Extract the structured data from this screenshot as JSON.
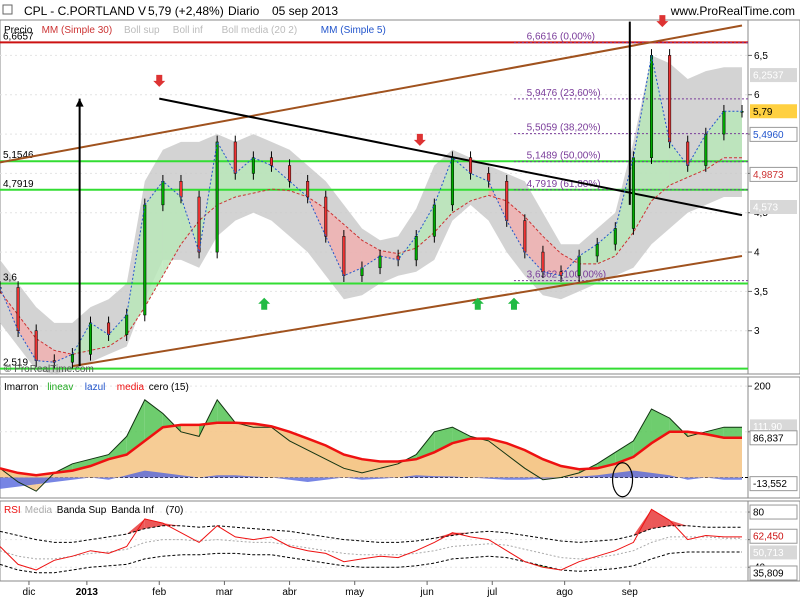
{
  "header": {
    "symbol": "CPL - C.PORTLAND V",
    "price_info": "5,79 (+2,48%)",
    "period": "Diario",
    "date": "05 sep 2013",
    "site": "www.ProRealTime.com"
  },
  "copyright": "© ProRealTime.com",
  "x_axis_labels": [
    "dic",
    "2013",
    "feb",
    "mar",
    "abr",
    "may",
    "jun",
    "jul",
    "ago",
    "sep"
  ],
  "chart_data": [
    {
      "type": "line",
      "panel": "price",
      "legend": [
        "Precio",
        "MM (Simple 30)",
        "Boll sup",
        "Boll inf",
        "Boll media (20 2)",
        "MM (Simple 5)"
      ],
      "colors": {
        "price": "#2255cc",
        "mm30": "#cc3333",
        "boll_band": "#c8c8c8",
        "mm5": "#2255cc",
        "up_fill": "#b8e6b8",
        "down_fill": "#f0b0b0",
        "hline": "#33dd33",
        "resistance": "#cc1111",
        "channel": "#a0521e",
        "trend": "#000000"
      },
      "ylim": [
        2.45,
        6.95
      ],
      "y_ticks": [
        3,
        3.5,
        4,
        4.5,
        5,
        5.5,
        6,
        6.5
      ],
      "y_tick_labels": [
        "3",
        "3,5",
        "4",
        "4,5",
        "5",
        "5,5",
        "6",
        "6,5"
      ],
      "x": [
        0,
        5,
        10,
        15,
        20,
        25,
        30,
        35,
        40,
        45,
        50,
        55,
        60,
        65,
        70,
        75,
        80,
        85,
        90,
        95,
        100,
        105,
        110,
        115,
        120,
        125,
        130,
        135,
        140,
        145,
        150,
        155,
        160,
        165,
        170,
        175,
        180,
        185,
        190,
        195,
        200,
        205
      ],
      "price": [
        3.55,
        3.0,
        2.62,
        2.6,
        2.7,
        3.1,
        2.95,
        3.2,
        4.6,
        4.9,
        4.7,
        4.0,
        5.4,
        5.0,
        5.2,
        5.1,
        4.9,
        4.7,
        4.2,
        3.7,
        3.8,
        3.95,
        3.9,
        4.2,
        4.6,
        5.2,
        5.0,
        4.9,
        4.4,
        4.0,
        3.75,
        3.7,
        3.95,
        4.1,
        4.3,
        5.2,
        6.5,
        5.4,
        5.1,
        5.5,
        5.79,
        5.79
      ],
      "mm30": [
        3.5,
        3.2,
        2.9,
        2.75,
        2.7,
        2.75,
        2.8,
        2.95,
        3.3,
        3.7,
        4.1,
        4.4,
        4.6,
        4.7,
        4.75,
        4.8,
        4.78,
        4.7,
        4.55,
        4.35,
        4.15,
        4.02,
        3.98,
        4.05,
        4.25,
        4.5,
        4.65,
        4.72,
        4.65,
        4.45,
        4.2,
        3.98,
        3.85,
        3.85,
        3.95,
        4.25,
        4.65,
        4.85,
        4.95,
        5.05,
        5.2,
        5.2
      ],
      "boll_upper": [
        3.9,
        3.6,
        3.3,
        3.1,
        3.1,
        3.3,
        3.4,
        3.6,
        4.9,
        5.3,
        5.4,
        5.4,
        5.5,
        5.4,
        5.5,
        5.4,
        5.3,
        5.1,
        4.9,
        4.6,
        4.3,
        4.15,
        4.2,
        4.55,
        5.1,
        5.3,
        5.2,
        5.1,
        5.0,
        4.9,
        4.5,
        4.1,
        4.1,
        4.3,
        4.5,
        5.4,
        6.5,
        6.4,
        6.2,
        6.3,
        6.35,
        6.35
      ],
      "boll_lower": [
        3.1,
        2.8,
        2.5,
        2.45,
        2.5,
        2.6,
        2.7,
        2.8,
        3.4,
        3.9,
        3.9,
        3.8,
        4.2,
        4.4,
        4.5,
        4.4,
        4.2,
        4.0,
        3.7,
        3.4,
        3.45,
        3.6,
        3.7,
        3.75,
        3.9,
        4.4,
        4.6,
        4.4,
        4.0,
        3.7,
        3.45,
        3.4,
        3.5,
        3.6,
        3.7,
        3.8,
        4.1,
        4.3,
        4.5,
        4.6,
        4.7,
        4.7
      ],
      "horizontal_levels": [
        {
          "value": 6.6657,
          "label": "6,6657",
          "color": "#cc1111"
        },
        {
          "value": 5.1546,
          "label": "5,1546",
          "color": "#33dd33"
        },
        {
          "value": 4.7919,
          "label": "4,7919",
          "color": "#33dd33"
        },
        {
          "value": 3.6,
          "label": "3,6",
          "color": "#33dd33"
        },
        {
          "value": 2.519,
          "label": "2,519",
          "color": "#33dd33"
        }
      ],
      "fibonacci": [
        {
          "value": 6.6616,
          "label": "6,6616 (0,00%)"
        },
        {
          "value": 5.9476,
          "label": "5,9476 (23,60%)"
        },
        {
          "value": 5.5059,
          "label": "5,5059 (38,20%)"
        },
        {
          "value": 5.1489,
          "label": "5,1489 (50,00%)"
        },
        {
          "value": 4.7919,
          "label": "4,7919 (61,80%)"
        },
        {
          "value": 3.6362,
          "label": "3,6362 (100,00%)"
        }
      ],
      "channel_upper": {
        "x": [
          0,
          205
        ],
        "y": [
          5.14,
          6.88
        ]
      },
      "channel_lower": {
        "x": [
          20,
          205
        ],
        "y": [
          2.55,
          3.95
        ]
      },
      "downtrend": {
        "x": [
          44,
          205
        ],
        "y": [
          5.95,
          4.47
        ]
      },
      "arrows_down": [
        {
          "x": 44,
          "y": 6.1
        },
        {
          "x": 116,
          "y": 5.35
        },
        {
          "x": 183,
          "y": 6.86
        }
      ],
      "arrows_up": [
        {
          "x": 73,
          "y": 3.42
        },
        {
          "x": 132,
          "y": 3.42
        },
        {
          "x": 142,
          "y": 3.42
        }
      ],
      "verticals": [
        {
          "x": 22,
          "y0": 2.55,
          "y1": 5.95,
          "arrow": true
        },
        {
          "x": 174,
          "y0": 4.6,
          "y1": 6.93,
          "arrow": false
        }
      ],
      "right_labels": [
        {
          "value": 6.25,
          "label": "6,2537",
          "bg": "#d8d8d8",
          "fg": "#ffffff"
        },
        {
          "value": 5.79,
          "label": "5,79",
          "bg": "#ffd040",
          "fg": "#000000"
        },
        {
          "value": 5.496,
          "label": "5,4960",
          "bg": "#ffffff",
          "fg": "#2255cc"
        },
        {
          "value": 4.9873,
          "label": "4,9873",
          "bg": "#ffffff",
          "fg": "#cc3333"
        },
        {
          "value": 4.573,
          "label": "4,573",
          "bg": "#d8d8d8",
          "fg": "#ffffff"
        }
      ]
    },
    {
      "type": "area",
      "panel": "imarron",
      "legend": [
        "Imarron",
        "lineav",
        "lazul",
        "media",
        "cero (15)"
      ],
      "ylim": [
        -45,
        220
      ],
      "y_ticks": [
        100,
        200
      ],
      "y_tick_labels": [
        "100",
        "200"
      ],
      "x": [
        0,
        5,
        10,
        15,
        20,
        25,
        30,
        35,
        40,
        45,
        50,
        55,
        60,
        65,
        70,
        75,
        80,
        85,
        90,
        95,
        100,
        105,
        110,
        115,
        120,
        125,
        130,
        135,
        140,
        145,
        150,
        155,
        160,
        165,
        170,
        175,
        180,
        185,
        190,
        195,
        200,
        205
      ],
      "series": [
        {
          "name": "Imarron",
          "values": [
            20,
            -10,
            -30,
            10,
            30,
            40,
            50,
            90,
            170,
            140,
            100,
            90,
            170,
            120,
            110,
            110,
            80,
            60,
            40,
            20,
            10,
            20,
            30,
            50,
            100,
            110,
            90,
            80,
            50,
            20,
            -5,
            0,
            10,
            30,
            55,
            80,
            150,
            130,
            90,
            100,
            110,
            110
          ]
        },
        {
          "name": "lazul",
          "values": [
            -25,
            -20,
            -15,
            -10,
            -5,
            0,
            -5,
            5,
            15,
            10,
            5,
            0,
            5,
            5,
            2,
            0,
            -5,
            -10,
            -5,
            0,
            -5,
            -3,
            0,
            5,
            3,
            2,
            0,
            -3,
            -5,
            -5,
            -3,
            0,
            2,
            5,
            10,
            15,
            10,
            5,
            -5,
            0,
            -5,
            -5
          ]
        },
        {
          "name": "media",
          "values": [
            20,
            10,
            5,
            10,
            15,
            25,
            40,
            50,
            80,
            110,
            115,
            115,
            120,
            120,
            118,
            112,
            100,
            85,
            70,
            50,
            40,
            35,
            35,
            40,
            55,
            75,
            85,
            85,
            75,
            60,
            40,
            25,
            18,
            20,
            30,
            45,
            75,
            100,
            100,
            95,
            87,
            87
          ]
        }
      ],
      "right_labels": [
        {
          "value": 111.9,
          "label": "111,90",
          "bg": "#d8d8d8",
          "fg": "#ffffff"
        },
        {
          "value": 86.837,
          "label": "86,837",
          "bg": "#ffffff",
          "fg": "#000000"
        },
        {
          "value": -13.552,
          "label": "-13,552",
          "bg": "#ffffff",
          "fg": "#000000"
        }
      ]
    },
    {
      "type": "line",
      "panel": "rsi",
      "legend": [
        "RSI",
        "Media",
        "Banda Sup",
        "Banda Inf",
        "(70)"
      ],
      "ylim": [
        30,
        88
      ],
      "y_ticks": [
        40,
        60,
        80
      ],
      "y_tick_labels": [
        "40",
        "60",
        "80"
      ],
      "x": [
        0,
        5,
        10,
        15,
        20,
        25,
        30,
        35,
        40,
        45,
        50,
        55,
        60,
        65,
        70,
        75,
        80,
        85,
        90,
        95,
        100,
        105,
        110,
        115,
        120,
        125,
        130,
        135,
        140,
        145,
        150,
        155,
        160,
        165,
        170,
        175,
        180,
        185,
        190,
        195,
        200,
        205
      ],
      "rsi": [
        55,
        42,
        38,
        45,
        48,
        52,
        50,
        55,
        75,
        72,
        65,
        58,
        70,
        62,
        60,
        62,
        55,
        52,
        50,
        44,
        46,
        48,
        47,
        52,
        58,
        65,
        62,
        60,
        52,
        44,
        40,
        38,
        44,
        48,
        52,
        58,
        82,
        74,
        60,
        63,
        62,
        62
      ],
      "media": [
        52,
        48,
        46,
        46,
        48,
        50,
        51,
        53,
        58,
        60,
        60,
        59,
        60,
        59,
        58,
        58,
        56,
        54,
        52,
        50,
        49,
        49,
        49,
        50,
        52,
        55,
        56,
        57,
        56,
        53,
        50,
        47,
        46,
        47,
        49,
        52,
        58,
        62,
        62,
        62,
        61,
        61
      ],
      "banda_sup": [
        66,
        63,
        60,
        58,
        58,
        60,
        62,
        64,
        68,
        70,
        70,
        69,
        70,
        69,
        68,
        67,
        66,
        64,
        62,
        60,
        59,
        58,
        58,
        59,
        61,
        63,
        65,
        66,
        65,
        63,
        61,
        59,
        58,
        59,
        60,
        63,
        68,
        70,
        70,
        69,
        69,
        69
      ],
      "banda_inf": [
        42,
        38,
        36,
        36,
        38,
        40,
        41,
        42,
        46,
        48,
        49,
        49,
        50,
        50,
        49,
        49,
        47,
        45,
        43,
        41,
        40,
        40,
        40,
        41,
        43,
        46,
        47,
        48,
        47,
        44,
        41,
        38,
        37,
        38,
        39,
        41,
        46,
        50,
        51,
        51,
        51,
        51
      ],
      "right_labels": [
        {
          "value": 80,
          "label": "80",
          "bg": "#ffffff",
          "fg": "#000000"
        },
        {
          "value": 62.45,
          "label": "62,450",
          "bg": "#ffffff",
          "fg": "#cc1111"
        },
        {
          "value": 50.713,
          "label": "50,713",
          "bg": "#d8d8d8",
          "fg": "#ffffff"
        },
        {
          "value": 35.809,
          "label": "35,809",
          "bg": "#ffffff",
          "fg": "#000000"
        }
      ]
    }
  ]
}
